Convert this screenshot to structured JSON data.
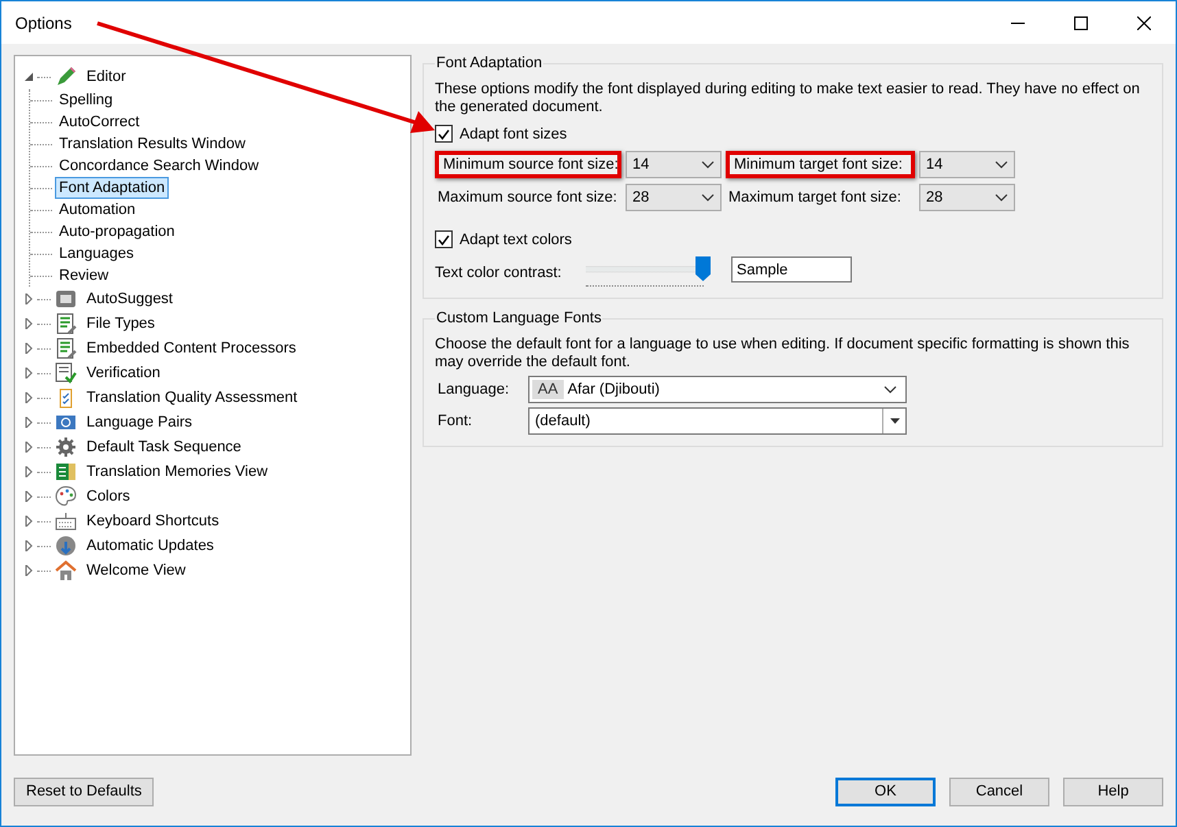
{
  "window": {
    "title": "Options"
  },
  "tree": [
    {
      "label": "Editor",
      "expanded": true,
      "selected": false,
      "children": [
        {
          "label": "Spelling",
          "selected": false
        },
        {
          "label": "AutoCorrect",
          "selected": false
        },
        {
          "label": "Translation Results Window",
          "selected": false
        },
        {
          "label": "Concordance Search Window",
          "selected": false
        },
        {
          "label": "Font Adaptation",
          "selected": true
        },
        {
          "label": "Automation",
          "selected": false
        },
        {
          "label": "Auto-propagation",
          "selected": false
        },
        {
          "label": "Languages",
          "selected": false
        },
        {
          "label": "Review",
          "selected": false
        }
      ]
    },
    {
      "label": "AutoSuggest",
      "expanded": false,
      "selected": false
    },
    {
      "label": "File Types",
      "expanded": false,
      "selected": false
    },
    {
      "label": "Embedded Content Processors",
      "expanded": false,
      "selected": false
    },
    {
      "label": "Verification",
      "expanded": false,
      "selected": false
    },
    {
      "label": "Translation Quality Assessment",
      "expanded": false,
      "selected": false
    },
    {
      "label": "Language Pairs",
      "expanded": false,
      "selected": false
    },
    {
      "label": "Default Task Sequence",
      "expanded": false,
      "selected": false
    },
    {
      "label": "Translation Memories View",
      "expanded": false,
      "selected": false
    },
    {
      "label": "Colors",
      "expanded": false,
      "selected": false
    },
    {
      "label": "Keyboard Shortcuts",
      "expanded": false,
      "selected": false
    },
    {
      "label": "Automatic Updates",
      "expanded": false,
      "selected": false
    },
    {
      "label": "Welcome View",
      "expanded": false,
      "selected": false
    }
  ],
  "font_adaptation": {
    "title": "Font Adaptation",
    "description": "These options modify the font displayed during editing to make text easier to read. They have no effect on the generated document.",
    "adapt_font_sizes": {
      "label": "Adapt font sizes",
      "checked": true
    },
    "size_fields": [
      {
        "label": "Minimum source font size:",
        "value": "14",
        "highlighted": true
      },
      {
        "label": "Minimum target font size:",
        "value": "14",
        "highlighted": true
      },
      {
        "label": "Maximum source font size:",
        "value": "28",
        "highlighted": false
      },
      {
        "label": "Maximum target font size:",
        "value": "28",
        "highlighted": false
      }
    ],
    "adapt_text_colors": {
      "label": "Adapt text colors",
      "checked": true
    },
    "contrast": {
      "label": "Text color contrast:",
      "level": 0.95
    },
    "sample": "Sample"
  },
  "custom_language_fonts": {
    "title": "Custom Language Fonts",
    "description": "Choose the default font for a language to use when editing. If document specific formatting is shown this may override the default font.",
    "language": {
      "label": "Language:",
      "badge": "AA",
      "value": "Afar (Djibouti)"
    },
    "font": {
      "label": "Font:",
      "value": "(default)"
    }
  },
  "buttons": {
    "reset": "Reset to Defaults",
    "dialog": [
      {
        "label": "OK",
        "default": true
      },
      {
        "label": "Cancel",
        "default": false
      },
      {
        "label": "Help",
        "default": false
      }
    ]
  }
}
